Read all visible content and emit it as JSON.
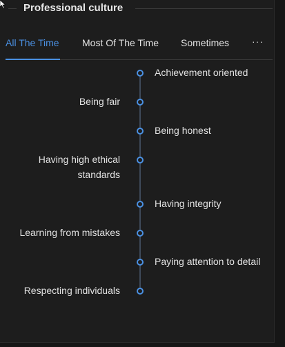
{
  "header": {
    "title": "Professional culture"
  },
  "tabs": [
    {
      "label": "All The Time",
      "active": true
    },
    {
      "label": "Most Of The Time",
      "active": false
    },
    {
      "label": "Sometimes",
      "active": false
    }
  ],
  "more_label": "···",
  "timeline": {
    "items": [
      {
        "label": "Achievement oriented",
        "side": "right"
      },
      {
        "label": "Being fair",
        "side": "left"
      },
      {
        "label": "Being honest",
        "side": "right"
      },
      {
        "label": "Having high ethical standards",
        "side": "left"
      },
      {
        "label": "Having integrity",
        "side": "right"
      },
      {
        "label": "Learning from mistakes",
        "side": "left"
      },
      {
        "label": "Paying attention to detail",
        "side": "right"
      },
      {
        "label": "Respecting individuals",
        "side": "left"
      }
    ]
  },
  "colors": {
    "accent": "#4a90e2",
    "background": "#1d1d1d",
    "text": "#e2e2e2"
  }
}
